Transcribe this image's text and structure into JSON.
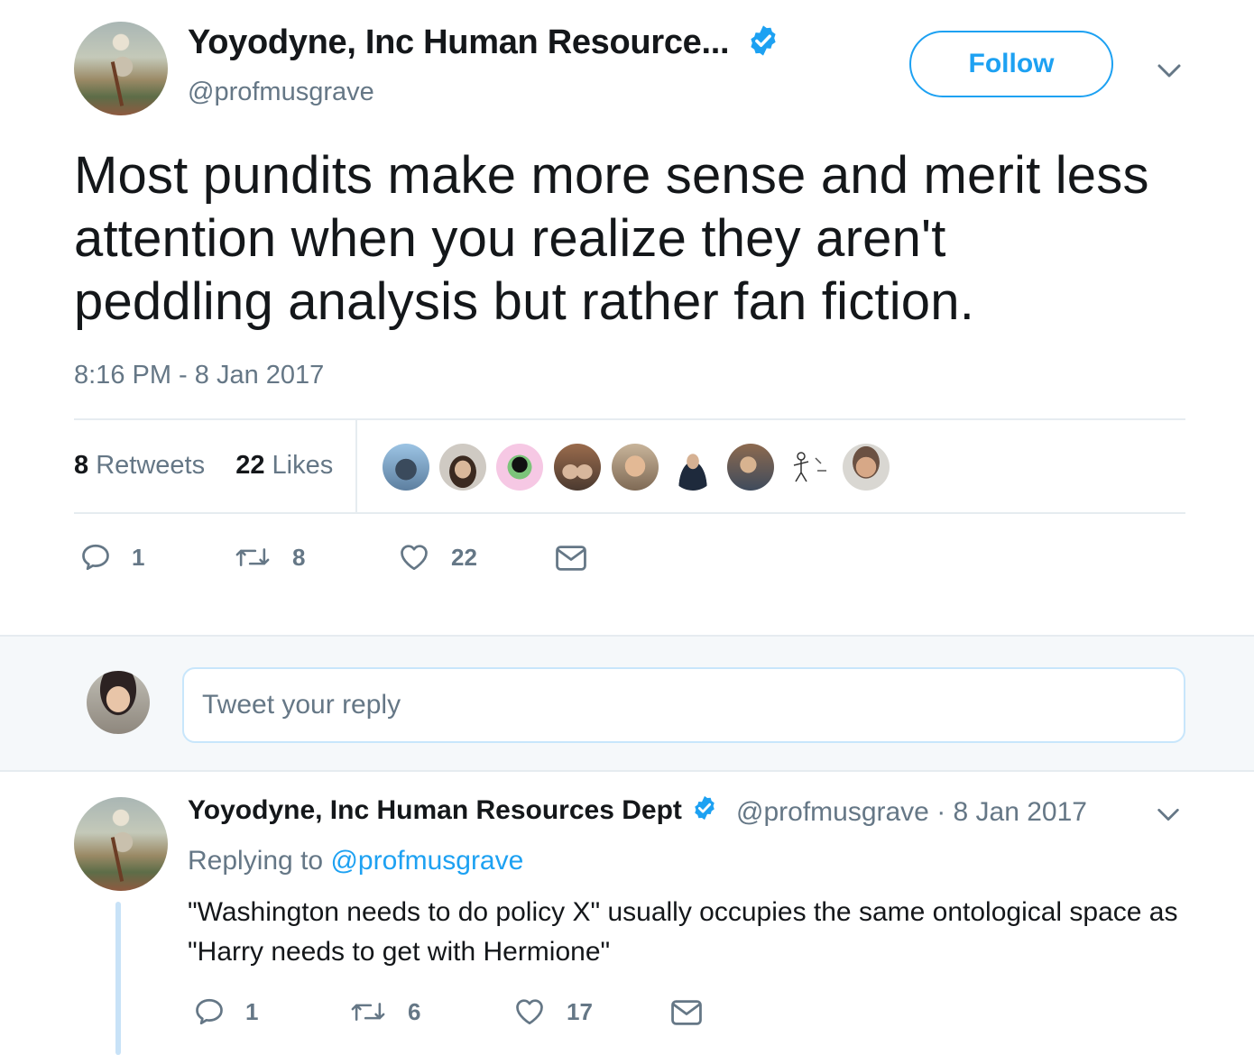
{
  "main_tweet": {
    "display_name": "Yoyodyne, Inc Human Resource...",
    "handle": "@profmusgrave",
    "follow_label": "Follow",
    "text": "Most pundits make more sense and merit less attention when you realize they aren't peddling analysis but rather fan fiction.",
    "timestamp": "8:16 PM - 8 Jan 2017",
    "stats": {
      "retweets_count": "8",
      "retweets_label": "Retweets",
      "likes_count": "22",
      "likes_label": "Likes"
    },
    "actions": {
      "reply_count": "1",
      "retweet_count": "8",
      "like_count": "22"
    }
  },
  "composer": {
    "placeholder": "Tweet your reply"
  },
  "reply_tweet": {
    "display_name": "Yoyodyne, Inc Human Resources Dept",
    "meta": "@profmusgrave · 8 Jan 2017",
    "replying_prefix": "Replying to",
    "replying_handle": "@profmusgrave",
    "text": "\"Washington needs to do policy X\" usually occupies the same ontological space as \"Harry needs to get with Hermione\"",
    "actions": {
      "reply_count": "1",
      "retweet_count": "6",
      "like_count": "17"
    }
  },
  "colors": {
    "accent": "#1da1f2",
    "secondary_text": "#657786",
    "primary_text": "#14171a",
    "divider": "#e6ecf0"
  }
}
